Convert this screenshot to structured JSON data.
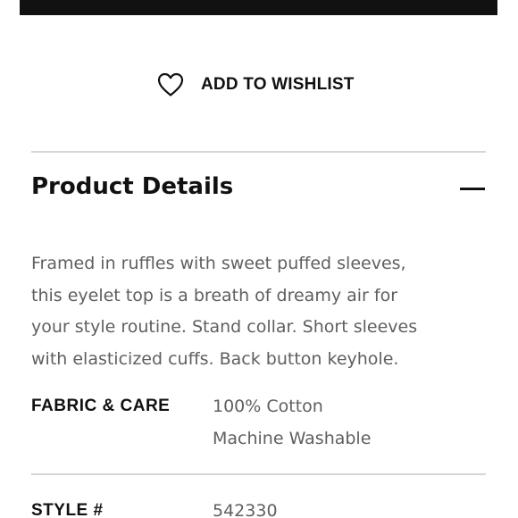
{
  "wishlist": {
    "icon": "heart-outline-icon",
    "label": "ADD TO WISHLIST"
  },
  "product_details": {
    "title": "Product Details",
    "toggle_icon": "minus-icon",
    "description_lines": [
      "Framed in ruffles with sweet puffed sleeves,",
      "this eyelet top is a breath of dreamy air for",
      "your style routine. Stand collar. Short sleeves",
      "with elasticized cuffs. Back button keyhole."
    ],
    "fabric_care": {
      "label": "FABRIC & CARE",
      "values": [
        "100% Cotton",
        "Machine Washable"
      ]
    },
    "style": {
      "label": "STYLE #",
      "value": "542330"
    }
  }
}
